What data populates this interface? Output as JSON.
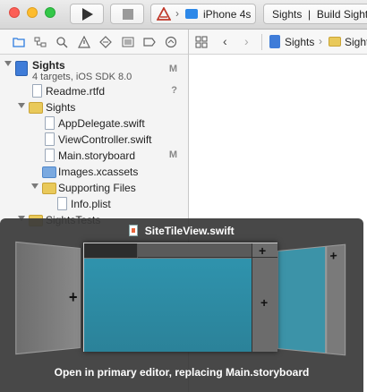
{
  "toolbar": {
    "scheme": {
      "target": "",
      "device": "iPhone 4s"
    },
    "activity": {
      "project": "Sights",
      "separator": "|",
      "status": "Build Sights"
    }
  },
  "navigator": {
    "tabs": [
      "folder-icon",
      "symbol-icon",
      "search-icon",
      "warning-icon",
      "test-icon",
      "debug-icon",
      "breakpoint-icon",
      "report-icon"
    ],
    "tree": [
      {
        "label": "Sights",
        "subtitle": "4 targets, iOS SDK 8.0",
        "badge": "M"
      },
      {
        "label": "Readme.rtfd",
        "badge": "?"
      },
      {
        "label": "Sights",
        "badge": ""
      },
      {
        "label": "AppDelegate.swift",
        "badge": ""
      },
      {
        "label": "ViewController.swift",
        "badge": ""
      },
      {
        "label": "Main.storyboard",
        "badge": "M"
      },
      {
        "label": "Images.xcassets",
        "badge": ""
      },
      {
        "label": "Supporting Files",
        "badge": ""
      },
      {
        "label": "Info.plist",
        "badge": ""
      },
      {
        "label": "SightsTests",
        "badge": ""
      }
    ]
  },
  "jump_bar": {
    "items": [
      "Sights",
      "Sights"
    ]
  },
  "overlay": {
    "file_name": "SiteTileView.swift",
    "caption": "Open in primary editor, replacing Main.storyboard",
    "plus": "+"
  }
}
